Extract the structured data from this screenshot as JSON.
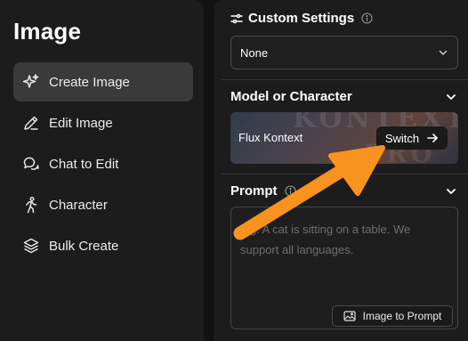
{
  "sidebar": {
    "title": "Image",
    "items": [
      {
        "label": "Create Image",
        "icon": "sparkle-icon",
        "active": true
      },
      {
        "label": "Edit Image",
        "icon": "pencil-icon",
        "active": false
      },
      {
        "label": "Chat to Edit",
        "icon": "chat-bubbles-icon",
        "active": false
      },
      {
        "label": "Character",
        "icon": "person-walking-icon",
        "active": false
      },
      {
        "label": "Bulk Create",
        "icon": "layers-icon",
        "active": false
      }
    ]
  },
  "custom_settings": {
    "title": "Custom Settings",
    "select_value": "None"
  },
  "model_section": {
    "title": "Model or Character",
    "model_name": "Flux Kontext",
    "card_bg_text_1": "KONTEXT",
    "card_bg_text_2": "PRO",
    "switch_label": "Switch"
  },
  "prompt_section": {
    "title": "Prompt",
    "placeholder": "e.g. A cat is sitting on a table. We support all languages.",
    "image_to_prompt_label": "Image to Prompt"
  },
  "colors": {
    "annotation_arrow": "#f7931e",
    "active_nav_bg": "#3a3a3a"
  }
}
